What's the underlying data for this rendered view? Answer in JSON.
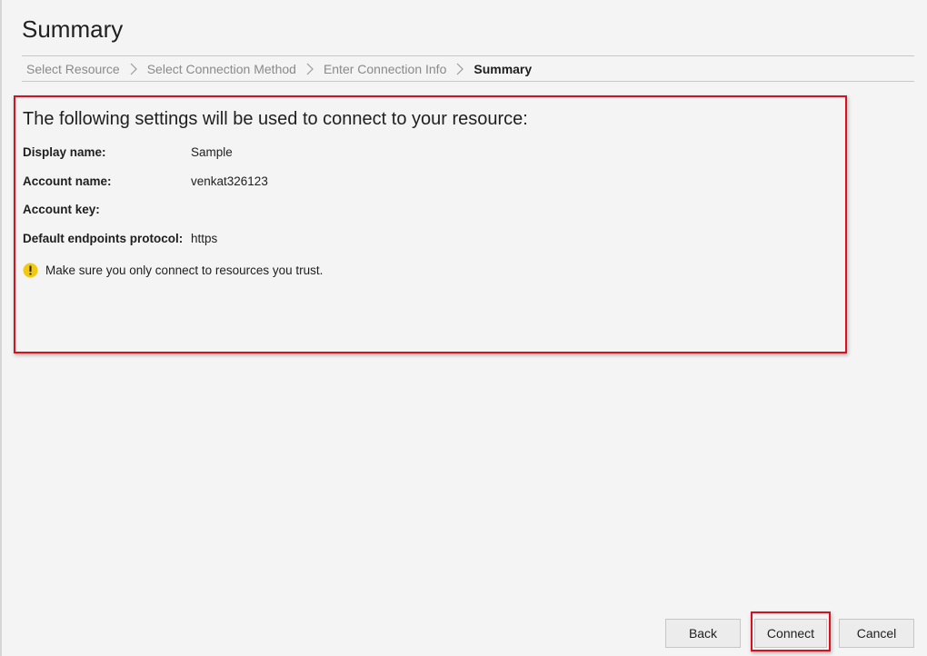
{
  "page": {
    "title": "Summary"
  },
  "breadcrumb": {
    "steps": [
      {
        "label": "Select Resource",
        "state": "inactive"
      },
      {
        "label": "Select Connection Method",
        "state": "inactive"
      },
      {
        "label": "Enter Connection Info",
        "state": "inactive"
      },
      {
        "label": "Summary",
        "state": "active"
      }
    ]
  },
  "summary": {
    "heading": "The following settings will be used to connect to your resource:",
    "fields": [
      {
        "label": "Display name:",
        "value": "Sample"
      },
      {
        "label": "Account name:",
        "value": "venkat326123"
      },
      {
        "label": "Account key:",
        "value": ""
      },
      {
        "label": "Default endpoints protocol:",
        "value": "https"
      }
    ],
    "warning": "Make sure you only connect to resources you trust."
  },
  "buttons": {
    "back": "Back",
    "connect": "Connect",
    "cancel": "Cancel"
  },
  "colors": {
    "highlight": "#d9101d",
    "warning_icon": "#f2c811",
    "active_step": "#1e1e1e",
    "inactive_step": "#8a8a8a"
  },
  "icons": {
    "breadcrumb_separator": "chevron-right-icon",
    "warning": "warning-icon"
  }
}
